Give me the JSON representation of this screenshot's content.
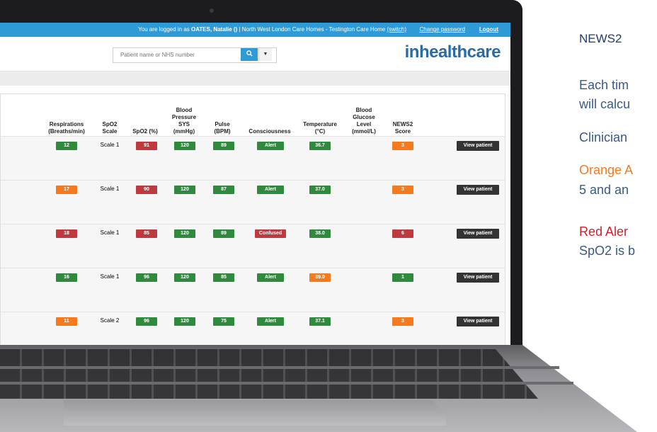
{
  "topbar": {
    "prefix": "You are logged in as ",
    "user": "OATES, Natalie ()",
    "org": " | North West London Care Homes - Testington Care Home ",
    "switch_label": "(switch)",
    "change_password": "Change password",
    "logout": "Logout"
  },
  "search": {
    "placeholder": "Patient name or NHS number",
    "search_icon": "search-icon",
    "dropdown_icon": "caret-down-icon"
  },
  "brand": {
    "name": "inhealthcare",
    "color": "#2b6aa6"
  },
  "columns": [
    "Respirations (Breaths/min)",
    "SpO2 Scale",
    "SpO2 (%)",
    "Blood Pressure SYS (mmHg)",
    "Pulse (BPM)",
    "Consciousness",
    "Temperature (°C)",
    "Blood Glucose Level (mmol/L)",
    "NEWS2 Score"
  ],
  "headers": {
    "resp": [
      "Respirations",
      "(Breaths/min)"
    ],
    "spo2scale": [
      "SpO2",
      "Scale"
    ],
    "spo2": [
      "SpO2 (%)"
    ],
    "bp": [
      "Blood",
      "Pressure",
      "SYS",
      "(mmHg)"
    ],
    "pulse": [
      "Pulse",
      "(BPM)"
    ],
    "consc": [
      "Consciousness"
    ],
    "temp": [
      "Temperature",
      "(°C)"
    ],
    "glucose": [
      "Blood",
      "Glucose",
      "Level",
      "(mmol/L)"
    ],
    "news": [
      "NEWS2",
      "Score"
    ]
  },
  "rows": [
    {
      "resp": "12",
      "resp_c": "green",
      "scale": "Scale 1",
      "spo2": "91",
      "spo2_c": "red",
      "bp": "120",
      "bp_c": "green",
      "pulse": "89",
      "pulse_c": "green",
      "consc": "Alert",
      "consc_c": "green",
      "temp": "36.7",
      "temp_c": "green",
      "news": "3",
      "news_c": "orange",
      "action": "View patient"
    },
    {
      "resp": "17",
      "resp_c": "orange",
      "scale": "Scale 1",
      "spo2": "90",
      "spo2_c": "red",
      "bp": "120",
      "bp_c": "green",
      "pulse": "87",
      "pulse_c": "green",
      "consc": "Alert",
      "consc_c": "green",
      "temp": "37.0",
      "temp_c": "green",
      "news": "3",
      "news_c": "orange",
      "action": "View patient"
    },
    {
      "resp": "18",
      "resp_c": "red",
      "scale": "Scale 1",
      "spo2": "85",
      "spo2_c": "red",
      "bp": "120",
      "bp_c": "green",
      "pulse": "89",
      "pulse_c": "green",
      "consc": "Confused",
      "consc_c": "red",
      "temp": "38.0",
      "temp_c": "green",
      "news": "6",
      "news_c": "red",
      "action": "View patient"
    },
    {
      "resp": "16",
      "resp_c": "green",
      "scale": "Scale 1",
      "spo2": "96",
      "spo2_c": "green",
      "bp": "120",
      "bp_c": "green",
      "pulse": "85",
      "pulse_c": "green",
      "consc": "Alert",
      "consc_c": "green",
      "temp": "39.0",
      "temp_c": "orange",
      "news": "1",
      "news_c": "green",
      "action": "View patient"
    },
    {
      "resp": "11",
      "resp_c": "orange",
      "scale": "Scale 2",
      "spo2": "96",
      "spo2_c": "green",
      "bp": "120",
      "bp_c": "green",
      "pulse": "75",
      "pulse_c": "green",
      "consc": "Alert",
      "consc_c": "green",
      "temp": "37.1",
      "temp_c": "green",
      "news": "3",
      "news_c": "orange",
      "action": "View patient"
    }
  ],
  "colors": {
    "green": "#2f8a3e",
    "orange": "#f47a20",
    "red": "#c0393e",
    "topbar": "#2e9bd6"
  },
  "side": {
    "title": "NEWS2 ",
    "line1": "Each tim",
    "line2": "will calcu",
    "line3": "Clinician",
    "orange_label": "Orange A",
    "line4": "5 and an",
    "red_label": "Red Aler",
    "line5": "SpO2 is b"
  }
}
